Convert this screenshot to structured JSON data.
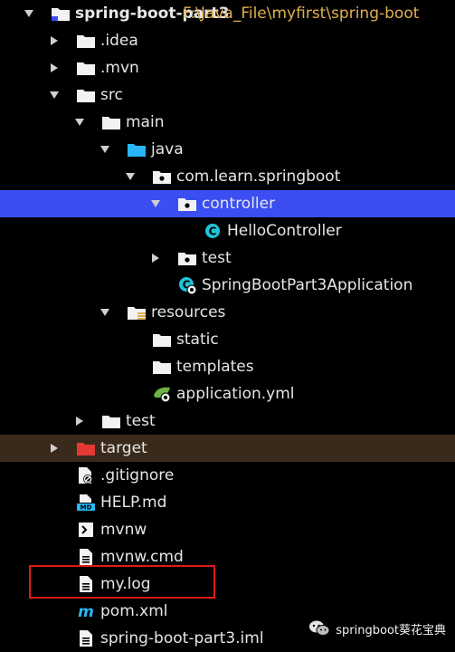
{
  "project": {
    "name": "spring-boot-part3",
    "path": "F:\\Java_File\\myfirst\\spring-boot"
  },
  "nodes": [
    {
      "label": "spring-boot-part3",
      "icon": "module-folder-icon",
      "arrow": "expanded",
      "level": 0
    },
    {
      "label": ".idea",
      "icon": "folder-icon",
      "arrow": "collapsed",
      "level": 1
    },
    {
      "label": ".mvn",
      "icon": "folder-icon",
      "arrow": "collapsed",
      "level": 1
    },
    {
      "label": "src",
      "icon": "folder-icon",
      "arrow": "expanded",
      "level": 1
    },
    {
      "label": "main",
      "icon": "folder-icon",
      "arrow": "expanded",
      "level": 2
    },
    {
      "label": "java",
      "icon": "source-root-folder-icon",
      "arrow": "expanded",
      "level": 3
    },
    {
      "label": "com.learn.springboot",
      "icon": "package-icon",
      "arrow": "expanded",
      "level": 4
    },
    {
      "label": "controller",
      "icon": "package-icon",
      "arrow": "expanded",
      "level": 5,
      "selected": true
    },
    {
      "label": "HelloController",
      "icon": "java-class-icon",
      "arrow": "none",
      "level": 6
    },
    {
      "label": "test",
      "icon": "package-icon",
      "arrow": "collapsed",
      "level": 5
    },
    {
      "label": "SpringBootPart3Application",
      "icon": "spring-boot-class-icon",
      "arrow": "none",
      "level": 5
    },
    {
      "label": "resources",
      "icon": "resources-root-folder-icon",
      "arrow": "expanded",
      "level": 3
    },
    {
      "label": "static",
      "icon": "folder-icon",
      "arrow": "none",
      "level": 4
    },
    {
      "label": "templates",
      "icon": "folder-icon",
      "arrow": "none",
      "level": 4
    },
    {
      "label": "application.yml",
      "icon": "spring-config-file-icon",
      "arrow": "none",
      "level": 4
    },
    {
      "label": "test",
      "icon": "folder-icon",
      "arrow": "collapsed",
      "level": 2
    },
    {
      "label": "target",
      "icon": "excluded-folder-icon",
      "arrow": "collapsed",
      "level": 1,
      "excluded": true
    },
    {
      "label": ".gitignore",
      "icon": "gitignore-file-icon",
      "arrow": "none",
      "level": 1
    },
    {
      "label": "HELP.md",
      "icon": "markdown-file-icon",
      "arrow": "none",
      "level": 1
    },
    {
      "label": "mvnw",
      "icon": "shell-script-icon",
      "arrow": "none",
      "level": 1
    },
    {
      "label": "mvnw.cmd",
      "icon": "text-file-icon",
      "arrow": "none",
      "level": 1
    },
    {
      "label": "my.log",
      "icon": "text-file-icon",
      "arrow": "none",
      "level": 1,
      "boxed": true
    },
    {
      "label": "pom.xml",
      "icon": "maven-file-icon",
      "arrow": "none",
      "level": 1
    },
    {
      "label": "spring-boot-part3.iml",
      "icon": "text-file-icon",
      "arrow": "none",
      "level": 1
    }
  ],
  "watermark": {
    "text": "springboot葵花宝典",
    "icon": "wechat-icon"
  },
  "colors": {
    "background": "#000000",
    "selected_row": "#3a4ef2",
    "excluded_row": "#3a2a1c",
    "path_hint": "#e0b050",
    "source_folder": "#29b6f6",
    "excluded_folder": "#e53935",
    "java_class": "#1fc4d8",
    "spring": "#6db33f",
    "highlight_box": "#e01818"
  }
}
